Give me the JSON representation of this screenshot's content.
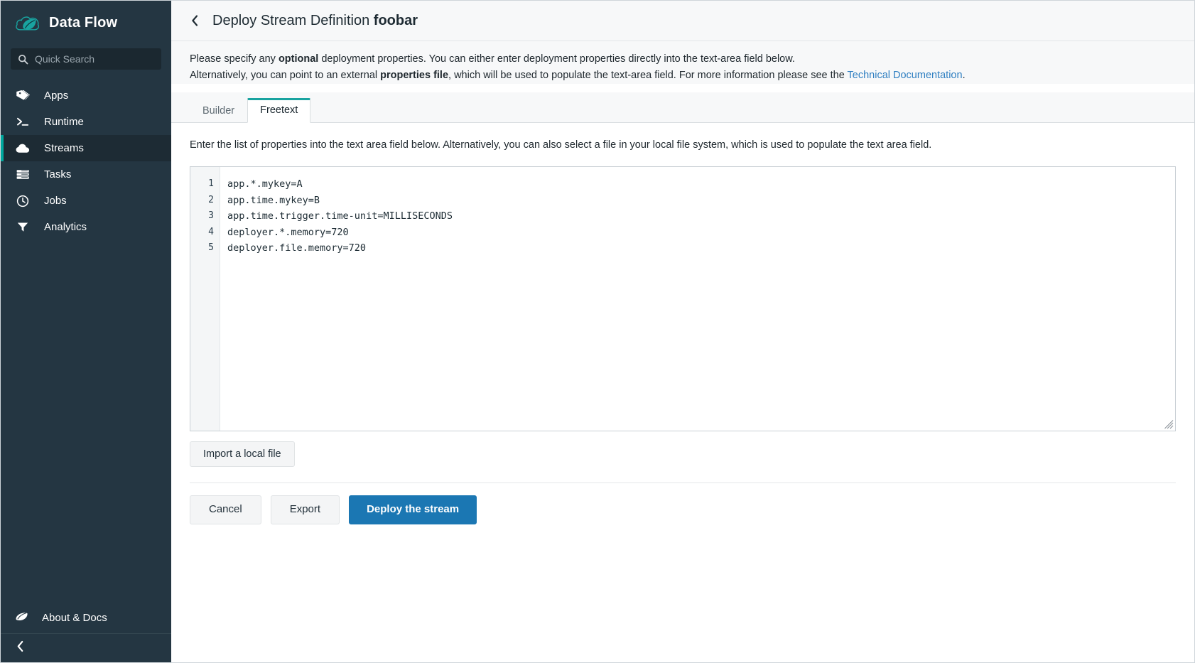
{
  "sidebar": {
    "brand": {
      "title": "Data Flow",
      "logo_icon": "spring-cloud-leaf-logo"
    },
    "search": {
      "placeholder": "Quick Search",
      "value": "",
      "icon": "search-icon"
    },
    "items": [
      {
        "label": "Apps",
        "icon": "tags-icon",
        "active": false
      },
      {
        "label": "Runtime",
        "icon": "terminal-icon",
        "active": false
      },
      {
        "label": "Streams",
        "icon": "cloud-icon",
        "active": true
      },
      {
        "label": "Tasks",
        "icon": "server-icon",
        "active": false
      },
      {
        "label": "Jobs",
        "icon": "clock-icon",
        "active": false
      },
      {
        "label": "Analytics",
        "icon": "funnel-icon",
        "active": false
      }
    ],
    "about": {
      "label": "About & Docs",
      "icon": "leaf-icon"
    },
    "collapse": {
      "icon": "chevron-left-icon",
      "label": ""
    },
    "colors": {
      "background": "#243642",
      "active_bg": "#1d2b34",
      "accent": "#00a79d"
    }
  },
  "header": {
    "back_icon": "chevron-left-icon",
    "title_prefix": "Deploy Stream Definition ",
    "title_stream": "foobar"
  },
  "intro": {
    "line1_a": "Please specify any ",
    "line1_b": "optional",
    "line1_c": " deployment properties. You can either enter deployment properties directly into the text-area field below.",
    "line2_a": "Alternatively, you can point to an external ",
    "line2_b": "properties file",
    "line2_c": ", which will be used to populate the text-area field. For more information please see the ",
    "link_text": "Technical Documentation",
    "line2_d": "."
  },
  "tabs": [
    {
      "label": "Builder",
      "active": false
    },
    {
      "label": "Freetext",
      "active": true
    }
  ],
  "content": {
    "hint": "Enter the list of properties into the text area field below. Alternatively, you can also select a file in your local file system, which is used to populate the text area field.",
    "editor": {
      "line_numbers": [
        "1",
        "2",
        "3",
        "4",
        "5"
      ],
      "lines": [
        "app.*.mykey=A",
        "app.time.mykey=B",
        "app.time.trigger.time-unit=MILLISECONDS",
        "deployer.*.memory=720",
        "deployer.file.memory=720"
      ],
      "resize_handle_icon": "resize-grip-icon"
    },
    "import_button": "Import a local file"
  },
  "actions": {
    "cancel": "Cancel",
    "export": "Export",
    "deploy": "Deploy the stream",
    "primary_color": "#1b77b3"
  }
}
